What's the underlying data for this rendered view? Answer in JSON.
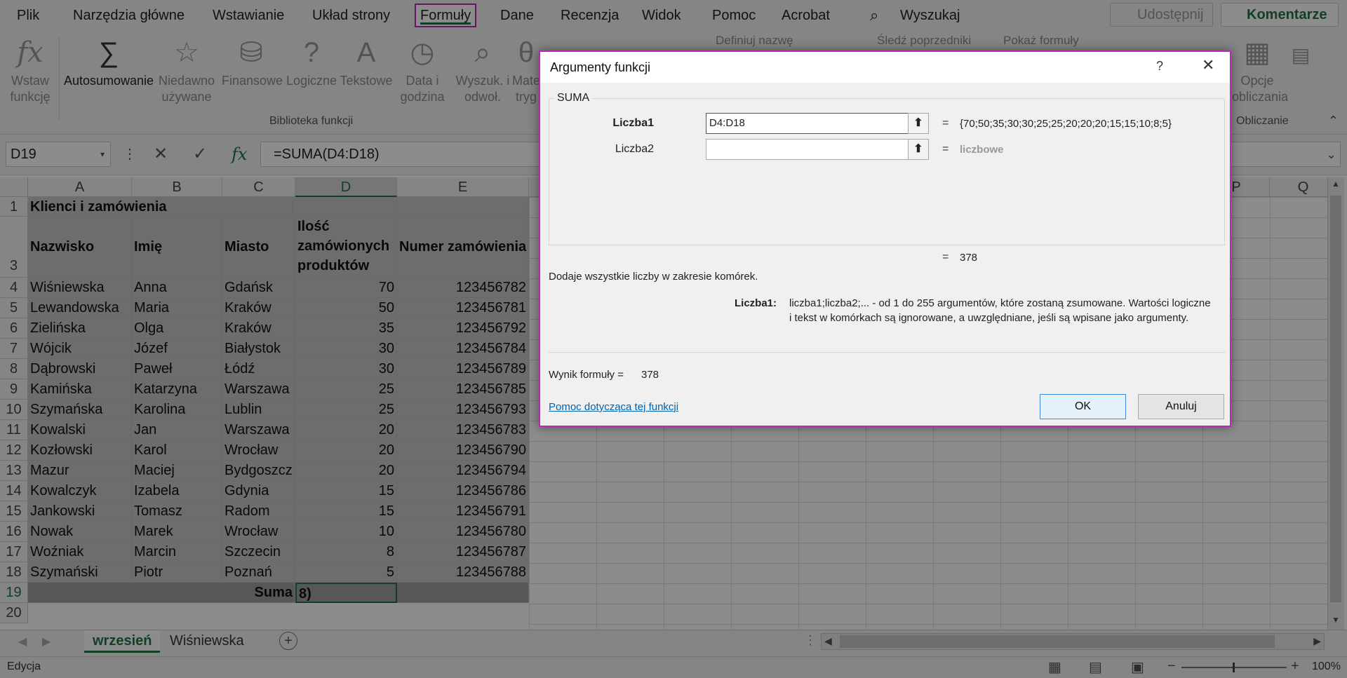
{
  "ribbon": {
    "tabs": [
      "Plik",
      "Narzędzia główne",
      "Wstawianie",
      "Układ strony",
      "Formuły",
      "Dane",
      "Recenzja",
      "Widok",
      "Pomoc",
      "Acrobat"
    ],
    "search_label": "Wyszukaj",
    "share_label": "Udostępnij",
    "comment_label": "Komentarze",
    "insert_function": "Wstaw funkcję",
    "autosum": "Autosumowanie",
    "recent": "Niedawno używane",
    "financial": "Finansowe",
    "logical": "Logiczne",
    "text": "Tekstowe",
    "datetime": "Data i godzina",
    "lookup": "Wyszuk. i odwoł.",
    "math": "Mate tryg",
    "library_group": "Biblioteka funkcji",
    "define_name": "Definiuj nazwę",
    "trace_precedents": "Śledź poprzedniki",
    "show_formulas": "Pokaż formuły",
    "calc_options": "Opcje obliczania",
    "calc_group": "Obliczanie"
  },
  "formula_bar": {
    "name_box": "D19",
    "formula": "=SUMA(D4:D18)"
  },
  "columns": [
    "A",
    "B",
    "C",
    "D",
    "E",
    "P",
    "Q"
  ],
  "sheet": {
    "title": "Klienci i zamówienia",
    "headers": [
      "Nazwisko",
      "Imię",
      "Miasto",
      "Ilość",
      "zamówionych",
      "produktów",
      "Numer zamówienia"
    ],
    "rows": [
      [
        "Wiśniewska",
        "Anna",
        "Gdańsk",
        "70",
        "123456782"
      ],
      [
        "Lewandowska",
        "Maria",
        "Kraków",
        "50",
        "123456781"
      ],
      [
        "Zielińska",
        "Olga",
        "Kraków",
        "35",
        "123456792"
      ],
      [
        "Wójcik",
        "Józef",
        "Białystok",
        "30",
        "123456784"
      ],
      [
        "Dąbrowski",
        "Paweł",
        "Łódź",
        "30",
        "123456789"
      ],
      [
        "Kamińska",
        "Katarzyna",
        "Warszawa",
        "25",
        "123456785"
      ],
      [
        "Szymańska",
        "Karolina",
        "Lublin",
        "25",
        "123456793"
      ],
      [
        "Kowalski",
        "Jan",
        "Warszawa",
        "20",
        "123456783"
      ],
      [
        "Kozłowski",
        "Karol",
        "Wrocław",
        "20",
        "123456790"
      ],
      [
        "Mazur",
        "Maciej",
        "Bydgoszcz",
        "20",
        "123456794"
      ],
      [
        "Kowalczyk",
        "Izabela",
        "Gdynia",
        "15",
        "123456786"
      ],
      [
        "Jankowski",
        "Tomasz",
        "Radom",
        "15",
        "123456791"
      ],
      [
        "Nowak",
        "Marek",
        "Wrocław",
        "10",
        "123456780"
      ],
      [
        "Woźniak",
        "Marcin",
        "Szczecin",
        "8",
        "123456787"
      ],
      [
        "Szymański",
        "Piotr",
        "Poznań",
        "5",
        "123456788"
      ]
    ],
    "sum_label": "Suma",
    "sum_cell": "8)",
    "row_numbers": [
      "1",
      "3",
      "4",
      "5",
      "6",
      "7",
      "8",
      "9",
      "10",
      "11",
      "12",
      "13",
      "14",
      "15",
      "16",
      "17",
      "18",
      "19",
      "20"
    ]
  },
  "sheet_tabs": [
    "wrzesień",
    "Wiśniewska"
  ],
  "status": {
    "mode": "Edycja",
    "zoom": "100%"
  },
  "dialog": {
    "title": "Argumenty funkcji",
    "help": "?",
    "close": "✕",
    "function_name": "SUMA",
    "arg1_label": "Liczba1",
    "arg1_value": "D4:D18",
    "arg1_result": "{70;50;35;30;30;25;25;20;20;20;15;15;10;8;5}",
    "arg2_label": "Liczba2",
    "arg2_value": "",
    "arg2_result": "liczbowe",
    "eq": "=",
    "result_value": "378",
    "description": "Dodaje wszystkie liczby w zakresie komórek.",
    "arg_desc_label": "Liczba1:",
    "arg_desc_line1": "liczba1;liczba2;... - od 1 do 255 argumentów, które zostaną zsumowane. Wartości logiczne",
    "arg_desc_line2": "i tekst w komórkach są ignorowane, a uwzględniane, jeśli są wpisane jako argumenty.",
    "formula_result_label": "Wynik formuły =",
    "formula_result_value": "378",
    "help_link": "Pomoc dotycząca tej funkcji",
    "ok": "OK",
    "cancel": "Anuluj"
  }
}
